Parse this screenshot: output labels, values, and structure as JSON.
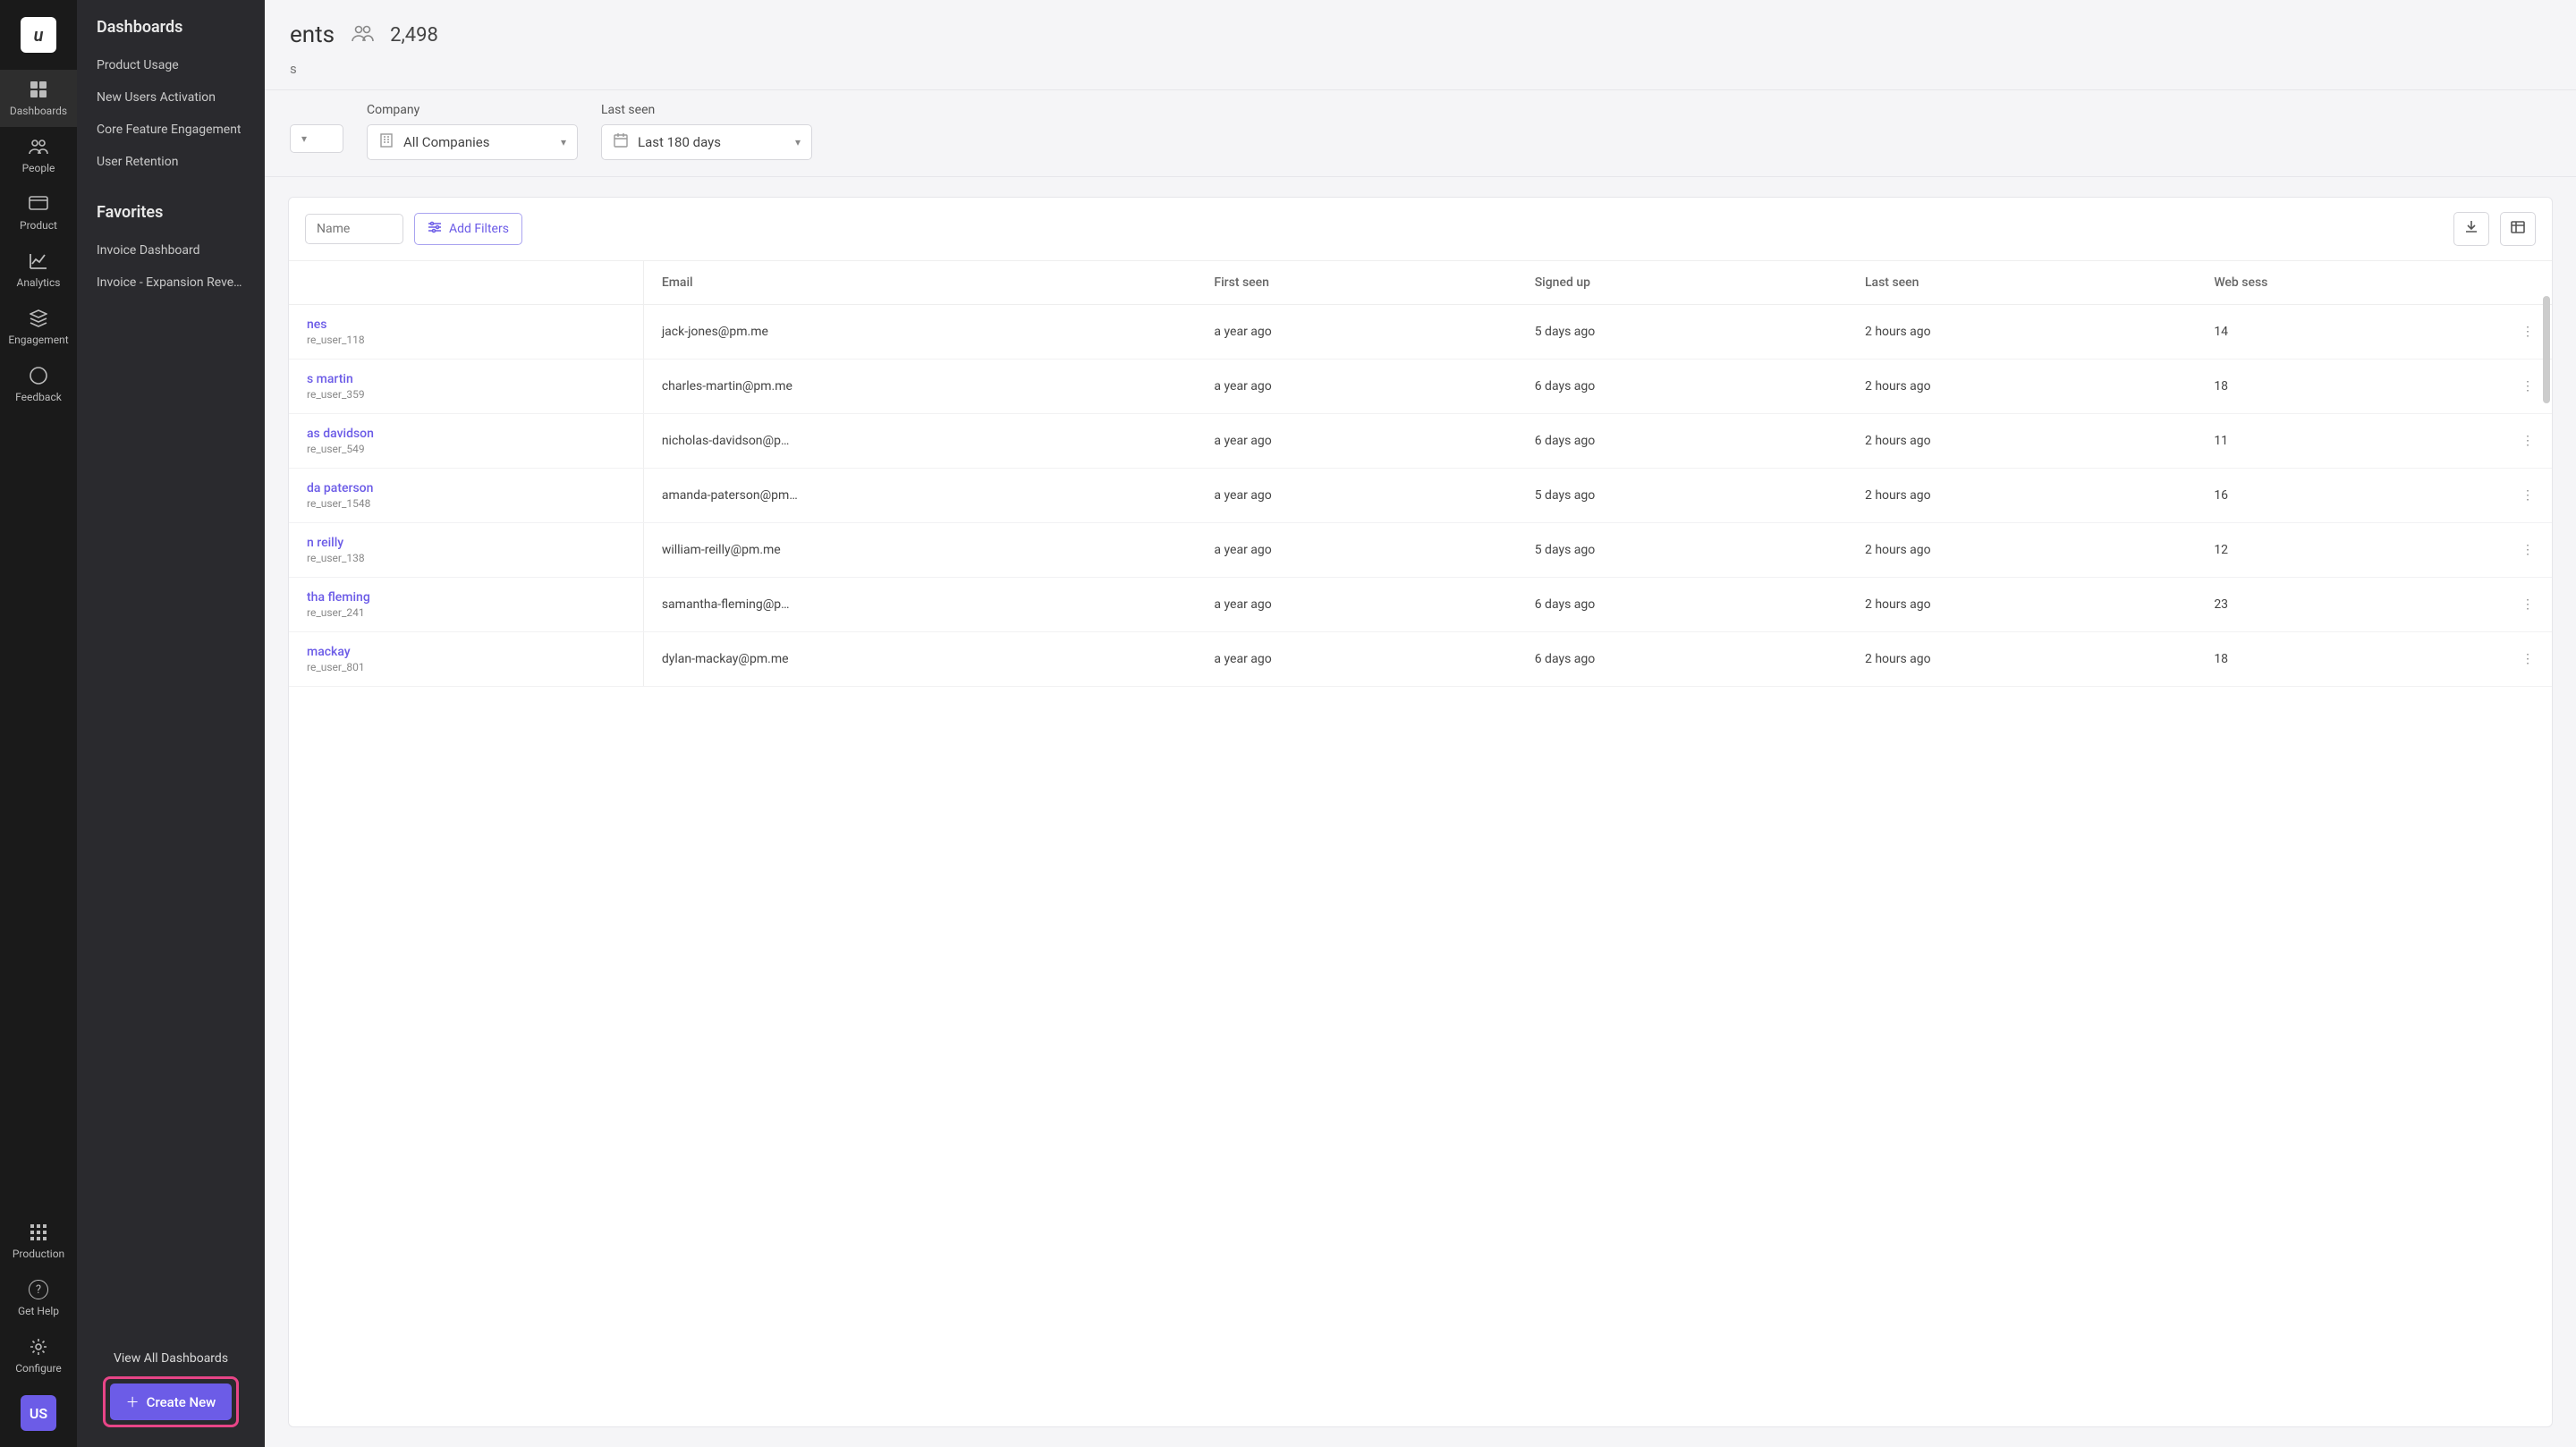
{
  "rail": {
    "items": [
      {
        "label": "Dashboards",
        "icon": "grid"
      },
      {
        "label": "People",
        "icon": "people"
      },
      {
        "label": "Product",
        "icon": "product"
      },
      {
        "label": "Analytics",
        "icon": "analytics"
      },
      {
        "label": "Engagement",
        "icon": "layers"
      },
      {
        "label": "Feedback",
        "icon": "feedback"
      }
    ],
    "bottom": [
      {
        "label": "Production",
        "icon": "apps"
      },
      {
        "label": "Get Help",
        "icon": "help"
      },
      {
        "label": "Configure",
        "icon": "gear"
      }
    ],
    "avatar": "US"
  },
  "flyout": {
    "header1": "Dashboards",
    "section1": [
      "Product Usage",
      "New Users Activation",
      "Core Feature Engagement",
      "User Retention"
    ],
    "header2": "Favorites",
    "section2": [
      "Invoice Dashboard",
      "Invoice - Expansion Reve…"
    ],
    "viewAll": "View All Dashboards",
    "createNew": "Create New"
  },
  "page": {
    "title_visible_fragment": "ents",
    "count": "2,498",
    "subline_visible_fragment": "s"
  },
  "filters": {
    "unknown_left_value_frag": "",
    "company_label": "Company",
    "company_value": "All Companies",
    "lastseen_label": "Last seen",
    "lastseen_value": "Last 180 days"
  },
  "toolbar": {
    "search_placeholder_fragment": "Name",
    "add_filters": "Add Filters"
  },
  "table": {
    "columns": [
      "",
      "Email",
      "First seen",
      "Signed up",
      "Last seen",
      "Web sess"
    ],
    "rows": [
      {
        "name_frag": "nes",
        "userid_frag": "re_user_118",
        "email": "jack-jones@pm.me",
        "first_seen": "a year ago",
        "signed_up": "5 days ago",
        "last_seen": "2 hours ago",
        "web": "14"
      },
      {
        "name_frag": "s martin",
        "userid_frag": "re_user_359",
        "email": "charles-martin@pm.me",
        "first_seen": "a year ago",
        "signed_up": "6 days ago",
        "last_seen": "2 hours ago",
        "web": "18"
      },
      {
        "name_frag": "as davidson",
        "userid_frag": "re_user_549",
        "email": "nicholas-davidson@p…",
        "first_seen": "a year ago",
        "signed_up": "6 days ago",
        "last_seen": "2 hours ago",
        "web": "11"
      },
      {
        "name_frag": "da paterson",
        "userid_frag": "re_user_1548",
        "email": "amanda-paterson@pm…",
        "first_seen": "a year ago",
        "signed_up": "5 days ago",
        "last_seen": "2 hours ago",
        "web": "16"
      },
      {
        "name_frag": "n reilly",
        "userid_frag": "re_user_138",
        "email": "william-reilly@pm.me",
        "first_seen": "a year ago",
        "signed_up": "5 days ago",
        "last_seen": "2 hours ago",
        "web": "12"
      },
      {
        "name_frag": "tha fleming",
        "userid_frag": "re_user_241",
        "email": "samantha-fleming@p…",
        "first_seen": "a year ago",
        "signed_up": "6 days ago",
        "last_seen": "2 hours ago",
        "web": "23"
      },
      {
        "name_frag": "mackay",
        "userid_frag": "re_user_801",
        "email": "dylan-mackay@pm.me",
        "first_seen": "a year ago",
        "signed_up": "6 days ago",
        "last_seen": "2 hours ago",
        "web": "18"
      }
    ]
  }
}
